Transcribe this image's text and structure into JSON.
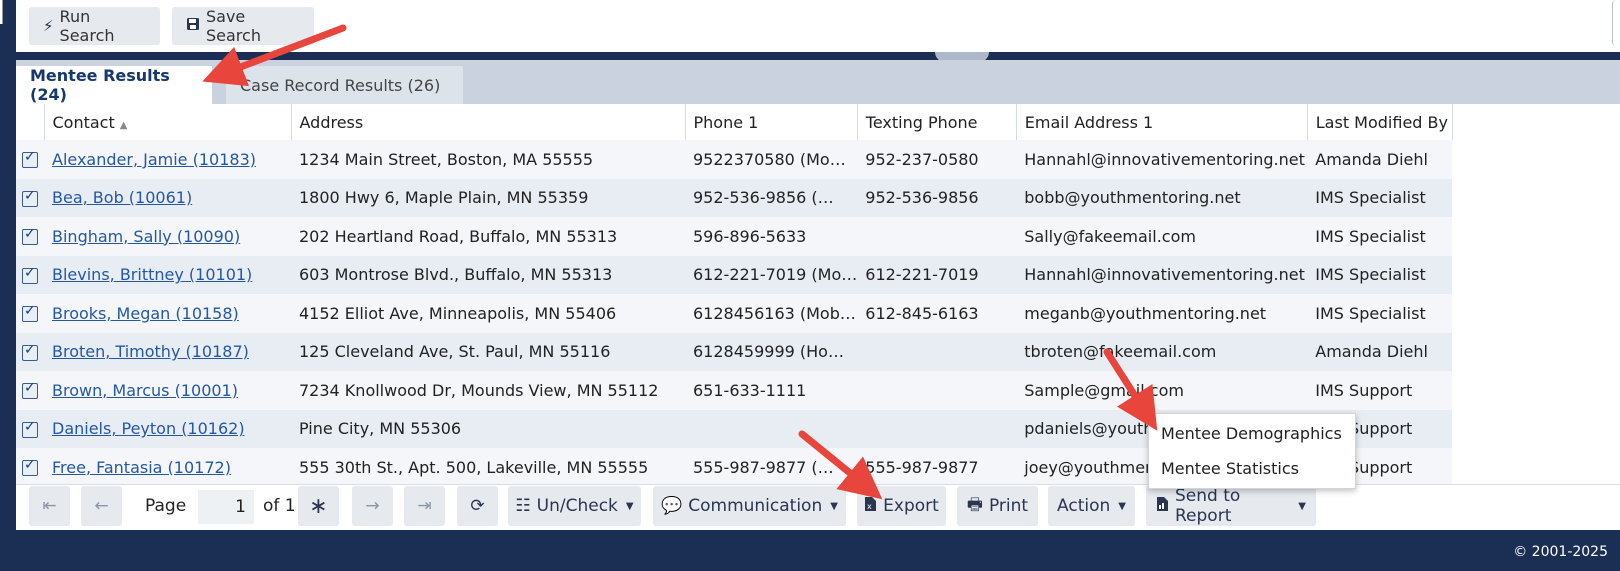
{
  "toolbar": {
    "run_search": "Run Search",
    "save_search": "Save Search"
  },
  "tabs": [
    {
      "label": "Mentee Results (24)",
      "active": true
    },
    {
      "label": "Case Record Results (26)",
      "active": false
    }
  ],
  "grid": {
    "columns": [
      "Contact",
      "Address",
      "Phone 1",
      "Texting Phone",
      "Email Address 1",
      "Last Modified By"
    ],
    "rows": [
      {
        "checked": true,
        "contact": "Alexander, Jamie (10183)",
        "address": "1234 Main Street, Boston, MA 55555",
        "phone1": "9522370580 (Mo…",
        "texting": "952-237-0580",
        "email": "Hannahl@innovativementoring.net",
        "modified_by": "Amanda Diehl"
      },
      {
        "checked": true,
        "contact": "Bea, Bob (10061)",
        "address": "1800 Hwy 6, Maple Plain, MN 55359",
        "phone1": "952-536-9856 (…",
        "texting": "952-536-9856",
        "email": "bobb@youthmentoring.net",
        "modified_by": "IMS Specialist"
      },
      {
        "checked": true,
        "contact": "Bingham, Sally (10090)",
        "address": "202 Heartland Road, Buffalo, MN 55313",
        "phone1": "596-896-5633",
        "texting": "",
        "email": "Sally@fakeemail.com",
        "modified_by": "IMS Specialist"
      },
      {
        "checked": true,
        "contact": "Blevins, Brittney (10101)",
        "address": "603 Montrose Blvd., Buffalo, MN 55313",
        "phone1": "612-221-7019 (Mo…",
        "texting": "612-221-7019",
        "email": "Hannahl@innovativementoring.net",
        "modified_by": "IMS Specialist"
      },
      {
        "checked": true,
        "contact": "Brooks, Megan (10158)",
        "address": "4152 Elliot Ave, Minneapolis, MN 55406",
        "phone1": "6128456163 (Mob…",
        "texting": "612-845-6163",
        "email": "meganb@youthmentoring.net",
        "modified_by": "IMS Specialist"
      },
      {
        "checked": true,
        "contact": "Broten, Timothy (10187)",
        "address": "125 Cleveland Ave, St. Paul, MN 55116",
        "phone1": "6128459999 (Ho…",
        "texting": "",
        "email": "tbroten@fakeemail.com",
        "modified_by": "Amanda Diehl"
      },
      {
        "checked": true,
        "contact": "Brown, Marcus (10001)",
        "address": "7234 Knollwood Dr, Mounds View, MN 55112",
        "phone1": "651-633-1111",
        "texting": "",
        "email": "Sample@gmail.com",
        "modified_by": "IMS Support"
      },
      {
        "checked": true,
        "contact": "Daniels, Peyton (10162)",
        "address": "Pine City, MN 55306",
        "phone1": "",
        "texting": "",
        "email": "pdaniels@youthmentoring.net",
        "modified_by": "IMS Support"
      },
      {
        "checked": true,
        "contact": "Free, Fantasia (10172)",
        "address": "555 30th St., Apt. 500, Lakeville, MN 55555",
        "phone1": "555-987-9877 (…",
        "texting": "555-987-9877",
        "email": "joey@youthmentoring.net",
        "modified_by": "IMS Support"
      }
    ]
  },
  "pager": {
    "page_label": "Page",
    "page_value": "1",
    "of_label": "of 1",
    "uncheck": "Un/Check",
    "communication": "Communication",
    "export": "Export",
    "print": "Print",
    "action": "Action",
    "send_to_report": "Send to Report"
  },
  "dropdown": {
    "items": [
      "Mentee Demographics",
      "Mentee Statistics"
    ]
  },
  "footer": {
    "copyright": "© 2001-2025"
  },
  "colors": {
    "navy": "#1b2f55",
    "link": "#2558a4",
    "arrow": "#e8453c"
  }
}
